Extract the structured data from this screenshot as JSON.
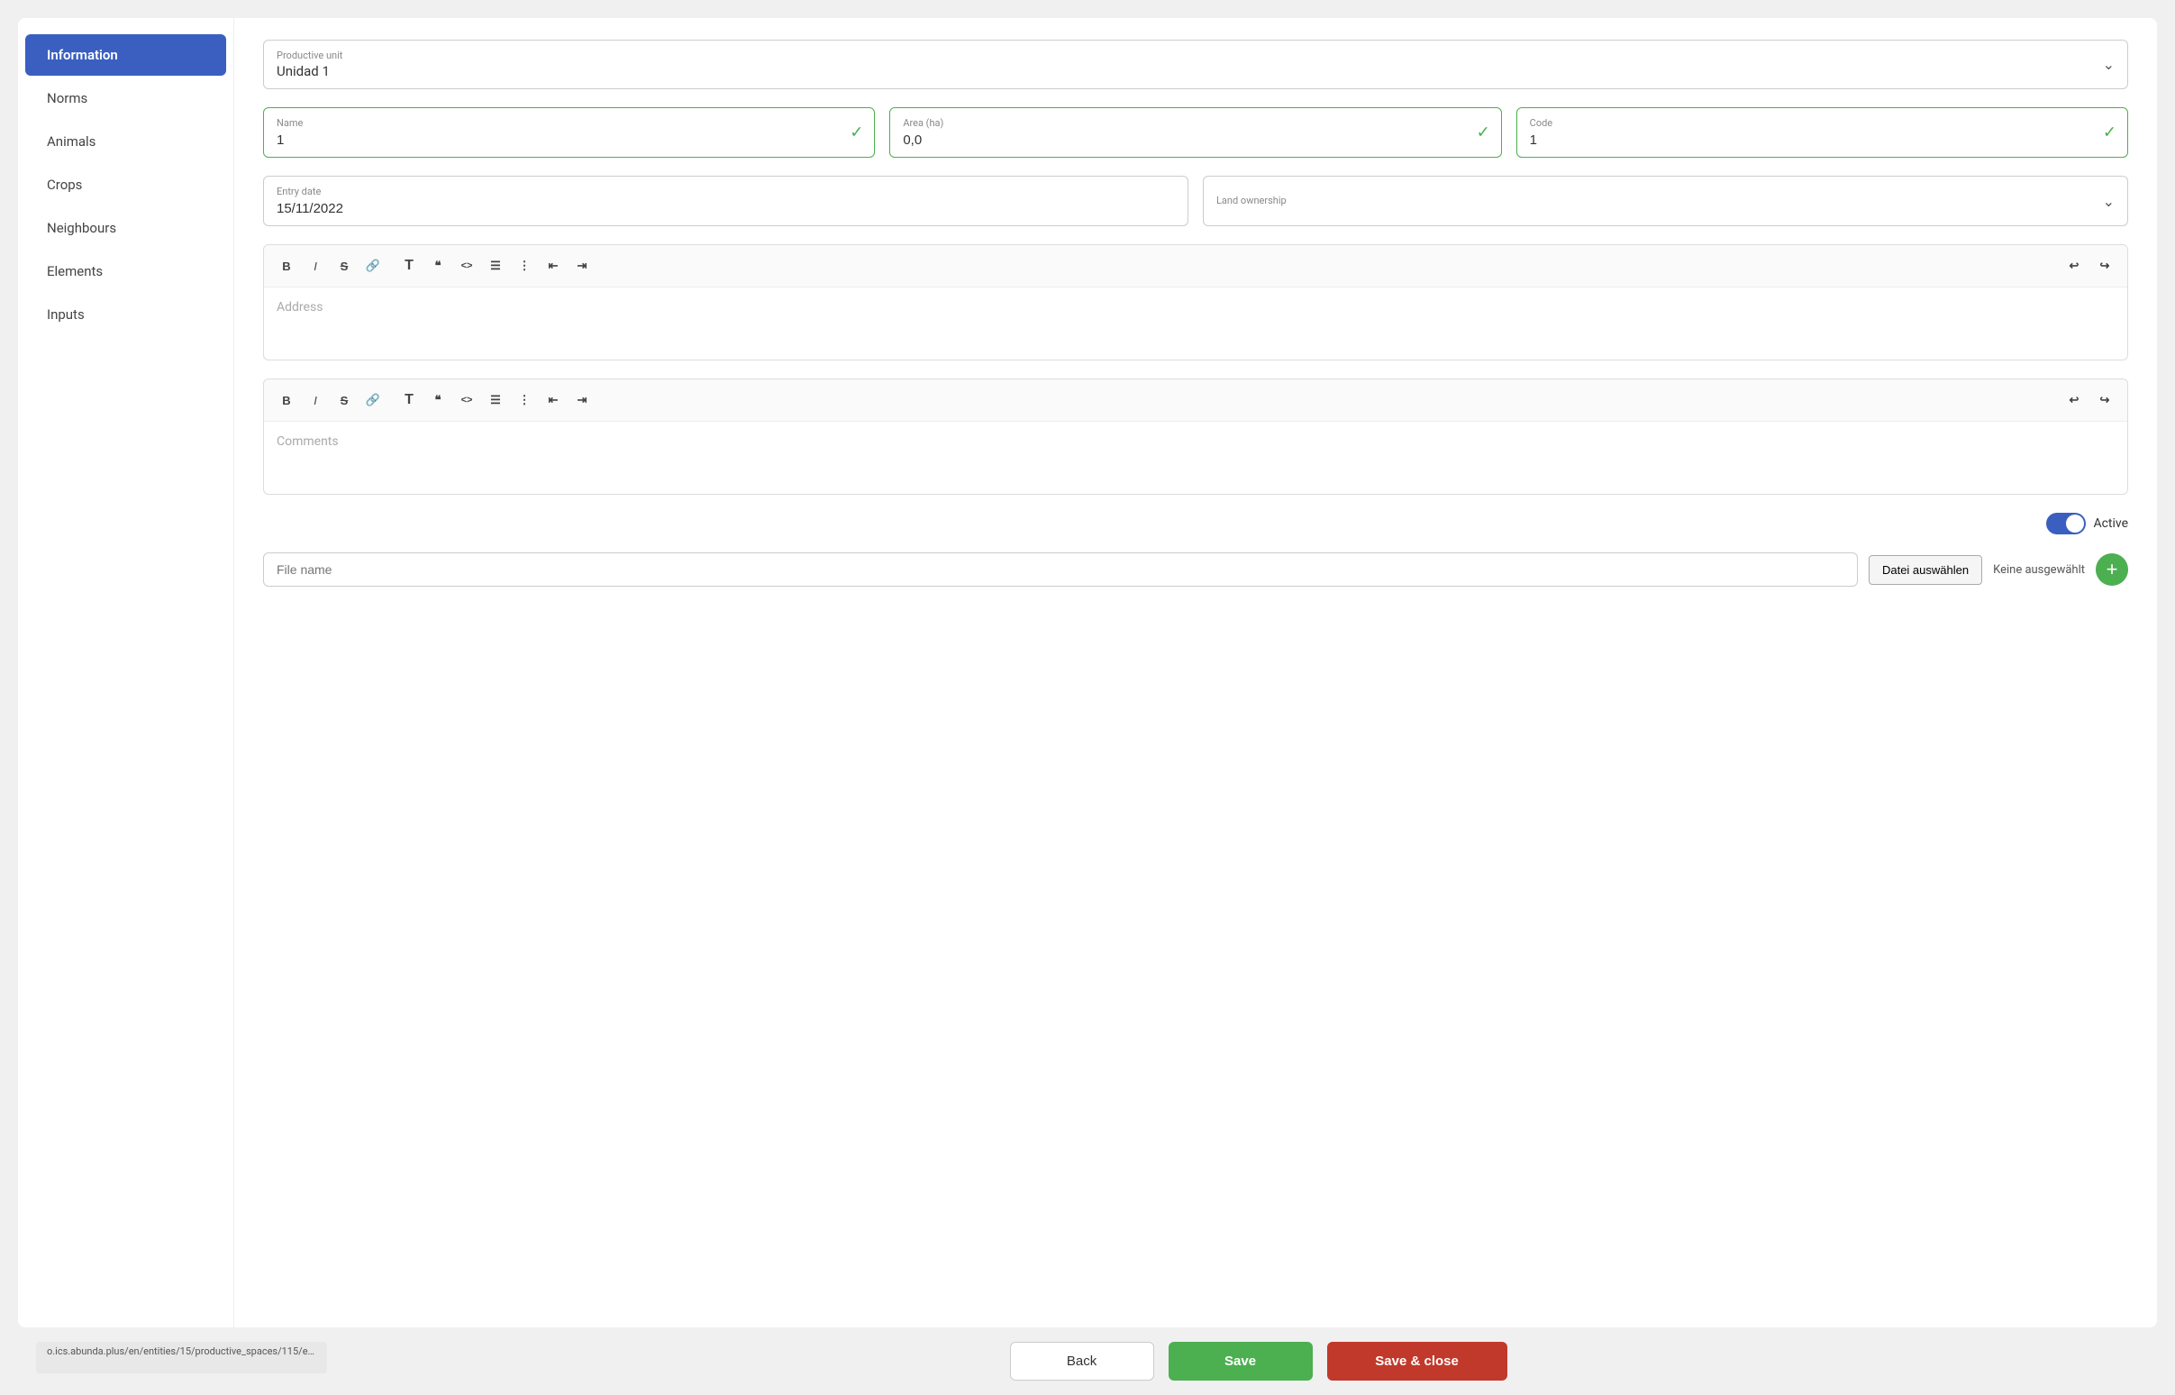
{
  "sidebar": {
    "items": [
      {
        "label": "Information",
        "active": true
      },
      {
        "label": "Norms",
        "active": false
      },
      {
        "label": "Animals",
        "active": false
      },
      {
        "label": "Crops",
        "active": false
      },
      {
        "label": "Neighbours",
        "active": false
      },
      {
        "label": "Elements",
        "active": false
      },
      {
        "label": "Inputs",
        "active": false
      }
    ]
  },
  "form": {
    "productive_unit_label": "Productive unit",
    "productive_unit_value": "Unidad 1",
    "name_label": "Name",
    "name_value": "1",
    "area_label": "Area (ha)",
    "area_value": "0,0",
    "code_label": "Code",
    "code_value": "1",
    "entry_date_label": "Entry date",
    "entry_date_value": "15/11/2022",
    "land_ownership_label": "Land ownership",
    "land_ownership_value": "",
    "address_placeholder": "Address",
    "comments_placeholder": "Comments",
    "active_label": "Active",
    "file_name_placeholder": "File name",
    "file_choose_label": "Datei auswählen",
    "file_no_chosen": "Keine ausgewählt"
  },
  "toolbar": {
    "bold": "B",
    "italic": "I",
    "strikethrough": "S̶",
    "link": "🔗",
    "text_size": "T",
    "blockquote": "❝",
    "code": "<>",
    "ul": "≡",
    "ol": "⊟",
    "indent_left": "⇤",
    "indent_right": "⇥",
    "undo": "↩",
    "redo": "↪"
  },
  "footer": {
    "back_label": "Back",
    "save_label": "Save",
    "save_close_label": "Save & close"
  },
  "url_bar": "o.ics.abunda.plus/en/entities/15/productive_spaces/115/edi..."
}
